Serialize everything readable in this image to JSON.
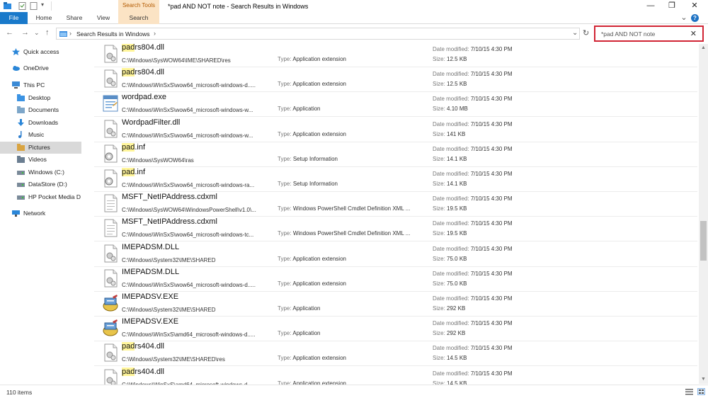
{
  "window": {
    "title": "*pad AND NOT note - Search Results in Windows",
    "minimize_glyph": "—",
    "maximize_glyph": "❐",
    "close_glyph": "✕",
    "expand_glyph": "⌄",
    "help_glyph": "?"
  },
  "ribbon": {
    "context_header": "Search Tools",
    "tabs": [
      "File",
      "Home",
      "Share",
      "View",
      "Search"
    ]
  },
  "address": {
    "back_glyph": "←",
    "forward_glyph": "→",
    "recent_glyph": "⌄",
    "up_glyph": "↑",
    "separator_glyph": "›",
    "location": "Search Results in Windows",
    "dropdown_glyph": "⌄",
    "refresh_glyph": "↻"
  },
  "search": {
    "value": "*pad AND NOT note",
    "clear_glyph": "✕"
  },
  "nav": {
    "items": [
      {
        "label": "Quick access",
        "icon": "star-icon"
      },
      {
        "label": "OneDrive",
        "icon": "cloud-icon"
      },
      {
        "label": "This PC",
        "icon": "computer-icon"
      },
      {
        "label": "Desktop",
        "icon": "desktop-folder-icon"
      },
      {
        "label": "Documents",
        "icon": "documents-folder-icon"
      },
      {
        "label": "Downloads",
        "icon": "downloads-icon"
      },
      {
        "label": "Music",
        "icon": "music-icon"
      },
      {
        "label": "Pictures",
        "icon": "pictures-folder-icon"
      },
      {
        "label": "Videos",
        "icon": "videos-folder-icon"
      },
      {
        "label": "Windows (C:)",
        "icon": "drive-icon"
      },
      {
        "label": "DataStore (D:)",
        "icon": "drive-icon"
      },
      {
        "label": "HP Pocket Media D",
        "icon": "drive-icon"
      },
      {
        "label": "Network",
        "icon": "network-icon"
      }
    ],
    "selected": "Pictures"
  },
  "labels": {
    "type": "Type:",
    "date_modified": "Date modified:",
    "size": "Size:"
  },
  "results": [
    {
      "hl": "pad",
      "rest": "rs804.dll",
      "path": "C:\\Windows\\SysWOW64\\IME\\SHARED\\res",
      "type": "Application extension",
      "date": "7/10/15 4:30 PM",
      "size": "12.5 KB",
      "icon": "dll-icon"
    },
    {
      "hl": "pad",
      "rest": "rs804.dll",
      "path": "C:\\Windows\\WinSxS\\wow64_microsoft-windows-d.....",
      "type": "Application extension",
      "date": "7/10/15 4:30 PM",
      "size": "12.5 KB",
      "icon": "dll-icon"
    },
    {
      "hl": "",
      "rest": "wordpad.exe",
      "path": "C:\\Windows\\WinSxS\\wow64_microsoft-windows-w...",
      "type": "Application",
      "date": "7/10/15 4:30 PM",
      "size": "4.10 MB",
      "icon": "wordpad-icon"
    },
    {
      "hl": "",
      "rest": "WordpadFilter.dll",
      "path": "C:\\Windows\\WinSxS\\wow64_microsoft-windows-w...",
      "type": "Application extension",
      "date": "7/10/15 4:30 PM",
      "size": "141 KB",
      "icon": "dll-icon"
    },
    {
      "hl": "pad",
      "rest": ".inf",
      "path": "C:\\Windows\\SysWOW64\\ras",
      "type": "Setup Information",
      "date": "7/10/15 4:30 PM",
      "size": "14.1 KB",
      "icon": "setup-info-icon"
    },
    {
      "hl": "pad",
      "rest": ".inf",
      "path": "C:\\Windows\\WinSxS\\wow64_microsoft-windows-ra...",
      "type": "Setup Information",
      "date": "7/10/15 4:30 PM",
      "size": "14.1 KB",
      "icon": "setup-info-icon"
    },
    {
      "hl": "",
      "rest": "MSFT_NetIPAddress.cdxml",
      "path": "C:\\Windows\\SysWOW64\\WindowsPowerShell\\v1.0\\...",
      "type": "Windows PowerShell Cmdlet Definition XML ...",
      "date": "7/10/15 4:30 PM",
      "size": "19.5 KB",
      "icon": "document-icon"
    },
    {
      "hl": "",
      "rest": "MSFT_NetIPAddress.cdxml",
      "path": "C:\\Windows\\WinSxS\\wow64_microsoft-windows-tc...",
      "type": "Windows PowerShell Cmdlet Definition XML ...",
      "date": "7/10/15 4:30 PM",
      "size": "19.5 KB",
      "icon": "document-icon"
    },
    {
      "hl": "",
      "rest": "IMEPADSM.DLL",
      "path": "C:\\Windows\\System32\\IME\\SHARED",
      "type": "Application extension",
      "date": "7/10/15 4:30 PM",
      "size": "75.0 KB",
      "icon": "dll-icon"
    },
    {
      "hl": "",
      "rest": "IMEPADSM.DLL",
      "path": "C:\\Windows\\WinSxS\\wow64_microsoft-windows-d.....",
      "type": "Application extension",
      "date": "7/10/15 4:30 PM",
      "size": "75.0 KB",
      "icon": "dll-icon"
    },
    {
      "hl": "",
      "rest": "IMEPADSV.EXE",
      "path": "C:\\Windows\\System32\\IME\\SHARED",
      "type": "Application",
      "date": "7/10/15 4:30 PM",
      "size": "292 KB",
      "icon": "imepad-exe-icon"
    },
    {
      "hl": "",
      "rest": "IMEPADSV.EXE",
      "path": "C:\\Windows\\WinSxS\\amd64_microsoft-windows-d.....",
      "type": "Application",
      "date": "7/10/15 4:30 PM",
      "size": "292 KB",
      "icon": "imepad-exe-icon"
    },
    {
      "hl": "pad",
      "rest": "rs404.dll",
      "path": "C:\\Windows\\System32\\IME\\SHARED\\res",
      "type": "Application extension",
      "date": "7/10/15 4:30 PM",
      "size": "14.5 KB",
      "icon": "dll-icon"
    },
    {
      "hl": "pad",
      "rest": "rs404.dll",
      "path": "C:\\Windows\\WinSxS\\amd64_microsoft-windows-d.....",
      "type": "Application extension",
      "date": "7/10/15 4:30 PM",
      "size": "14.5 KB",
      "icon": "dll-icon"
    }
  ],
  "status": {
    "item_count": "110 items"
  },
  "colors": {
    "file_tab": "#1979ca",
    "search_tools": "#fbe3c4",
    "search_highlight_border": "#d12434",
    "match_highlight": "#fff59a",
    "selected_nav": "#d9d9d9"
  }
}
